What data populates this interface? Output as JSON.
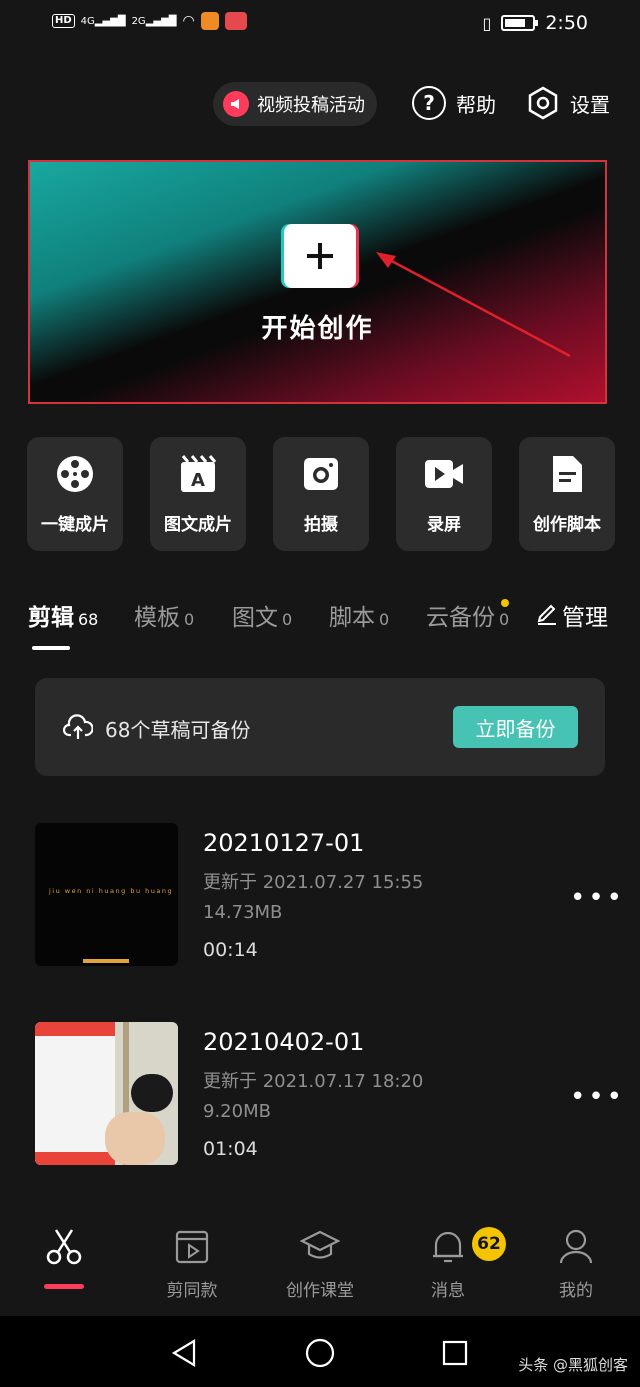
{
  "status_bar": {
    "left_text": "HD",
    "signal_1": "4G",
    "signal_2": "2G",
    "time": "2:50"
  },
  "top": {
    "activity_label": "视频投稿活动",
    "help_label": "帮助",
    "settings_label": "设置"
  },
  "hero": {
    "title": "开始创作",
    "plus": "+"
  },
  "tools": [
    {
      "label": "一键成片",
      "icon": "film-reel-icon"
    },
    {
      "label": "图文成片",
      "icon": "text-clapper-icon"
    },
    {
      "label": "拍摄",
      "icon": "camera-icon"
    },
    {
      "label": "录屏",
      "icon": "screen-record-icon"
    },
    {
      "label": "创作脚本",
      "icon": "script-doc-icon"
    }
  ],
  "tabs": [
    {
      "label": "剪辑",
      "count": "68"
    },
    {
      "label": "模板",
      "count": "0"
    },
    {
      "label": "图文",
      "count": "0"
    },
    {
      "label": "脚本",
      "count": "0"
    },
    {
      "label": "云备份",
      "count": "0"
    }
  ],
  "manage_label": "管理",
  "backup": {
    "text": "68个草稿可备份",
    "button": "立即备份"
  },
  "drafts": [
    {
      "title": "20210127-01",
      "updated": "更新于 2021.07.27 15:55",
      "size": "14.73MB",
      "duration": "00:14",
      "thumb_caption": "jiu wen ni huang bu huang"
    },
    {
      "title": "20210402-01",
      "updated": "更新于 2021.07.17 18:20",
      "size": "9.20MB",
      "duration": "01:04"
    }
  ],
  "more_glyph": "•••",
  "bottom_nav": {
    "edit": "",
    "template": "剪同款",
    "course": "创作课堂",
    "messages": "消息",
    "profile": "我的",
    "messages_badge": "62"
  },
  "watermark": "头条 @黑狐创客",
  "colors": {
    "accent_pink": "#ff3b5c",
    "accent_teal": "#47c3b4",
    "badge_yellow": "#f5c400"
  }
}
